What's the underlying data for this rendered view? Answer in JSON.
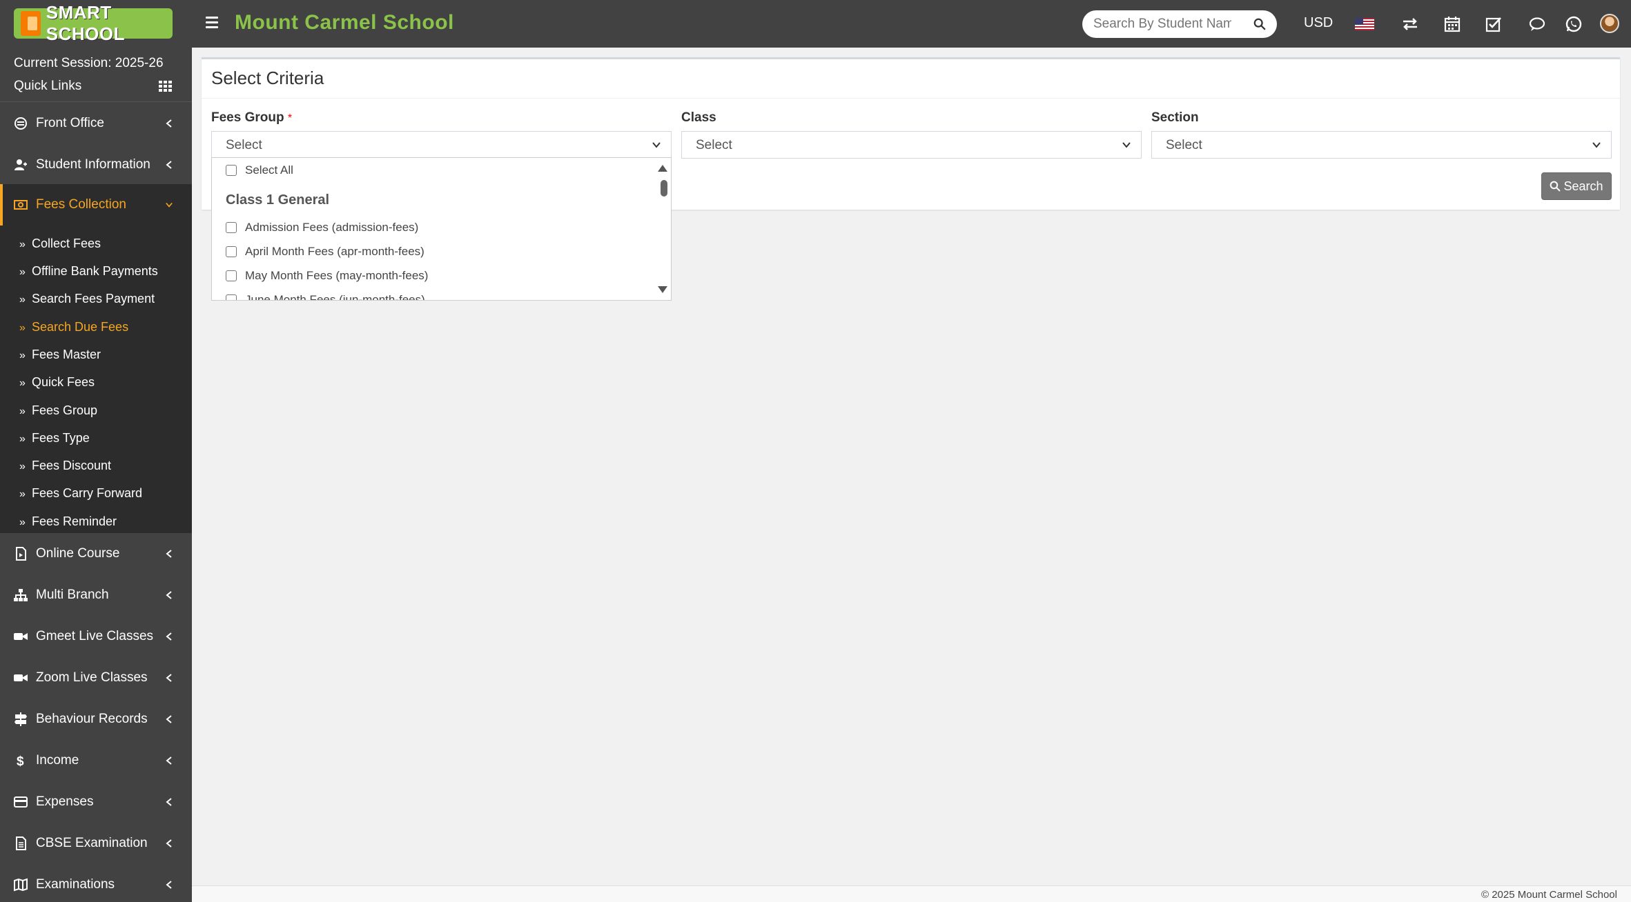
{
  "header": {
    "logo_text": "SMART SCHOOL",
    "school_name": "Mount Carmel School",
    "search_placeholder": "Search By Student Name",
    "currency": "USD"
  },
  "sidebar": {
    "session": "Current Session: 2025-26",
    "quick_links": "Quick Links",
    "items": [
      {
        "label": "Front Office",
        "icon": "front-office-icon"
      },
      {
        "label": "Student Information",
        "icon": "student-icon"
      },
      {
        "label": "Fees Collection",
        "icon": "money-icon"
      },
      {
        "label": "Online Course",
        "icon": "course-icon"
      },
      {
        "label": "Multi Branch",
        "icon": "sitemap-icon"
      },
      {
        "label": "Gmeet Live Classes",
        "icon": "video-icon"
      },
      {
        "label": "Zoom Live Classes",
        "icon": "video-icon"
      },
      {
        "label": "Behaviour Records",
        "icon": "signpost-icon"
      },
      {
        "label": "Income",
        "icon": "dollar-icon"
      },
      {
        "label": "Expenses",
        "icon": "credit-card-icon"
      },
      {
        "label": "CBSE Examination",
        "icon": "document-icon"
      },
      {
        "label": "Examinations",
        "icon": "map-icon"
      }
    ],
    "fees_submenu": [
      "Collect Fees",
      "Offline Bank Payments",
      "Search Fees Payment",
      "Search Due Fees",
      "Fees Master",
      "Quick Fees",
      "Fees Group",
      "Fees Type",
      "Fees Discount",
      "Fees Carry Forward",
      "Fees Reminder"
    ]
  },
  "main": {
    "title": "Select Criteria",
    "fees_group_label": "Fees Group",
    "required_mark": "*",
    "class_label": "Class",
    "section_label": "Section",
    "fees_group_value": "Select",
    "class_value": "Select",
    "section_value": "Select",
    "search_button": "Search"
  },
  "dropdown": {
    "select_all": "Select All",
    "group_name": "Class 1 General",
    "options": [
      "Admission Fees (admission-fees)",
      "April Month Fees (apr-month-fees)",
      "May Month Fees (may-month-fees)",
      "June Month Fees (jun-month-fees)"
    ]
  },
  "footer": {
    "copyright": "© 2025 Mount Carmel School"
  },
  "colors": {
    "header_bg": "#424242",
    "accent_green": "#8bc34a",
    "accent_orange": "#f5a623",
    "button_gray": "#777777"
  }
}
